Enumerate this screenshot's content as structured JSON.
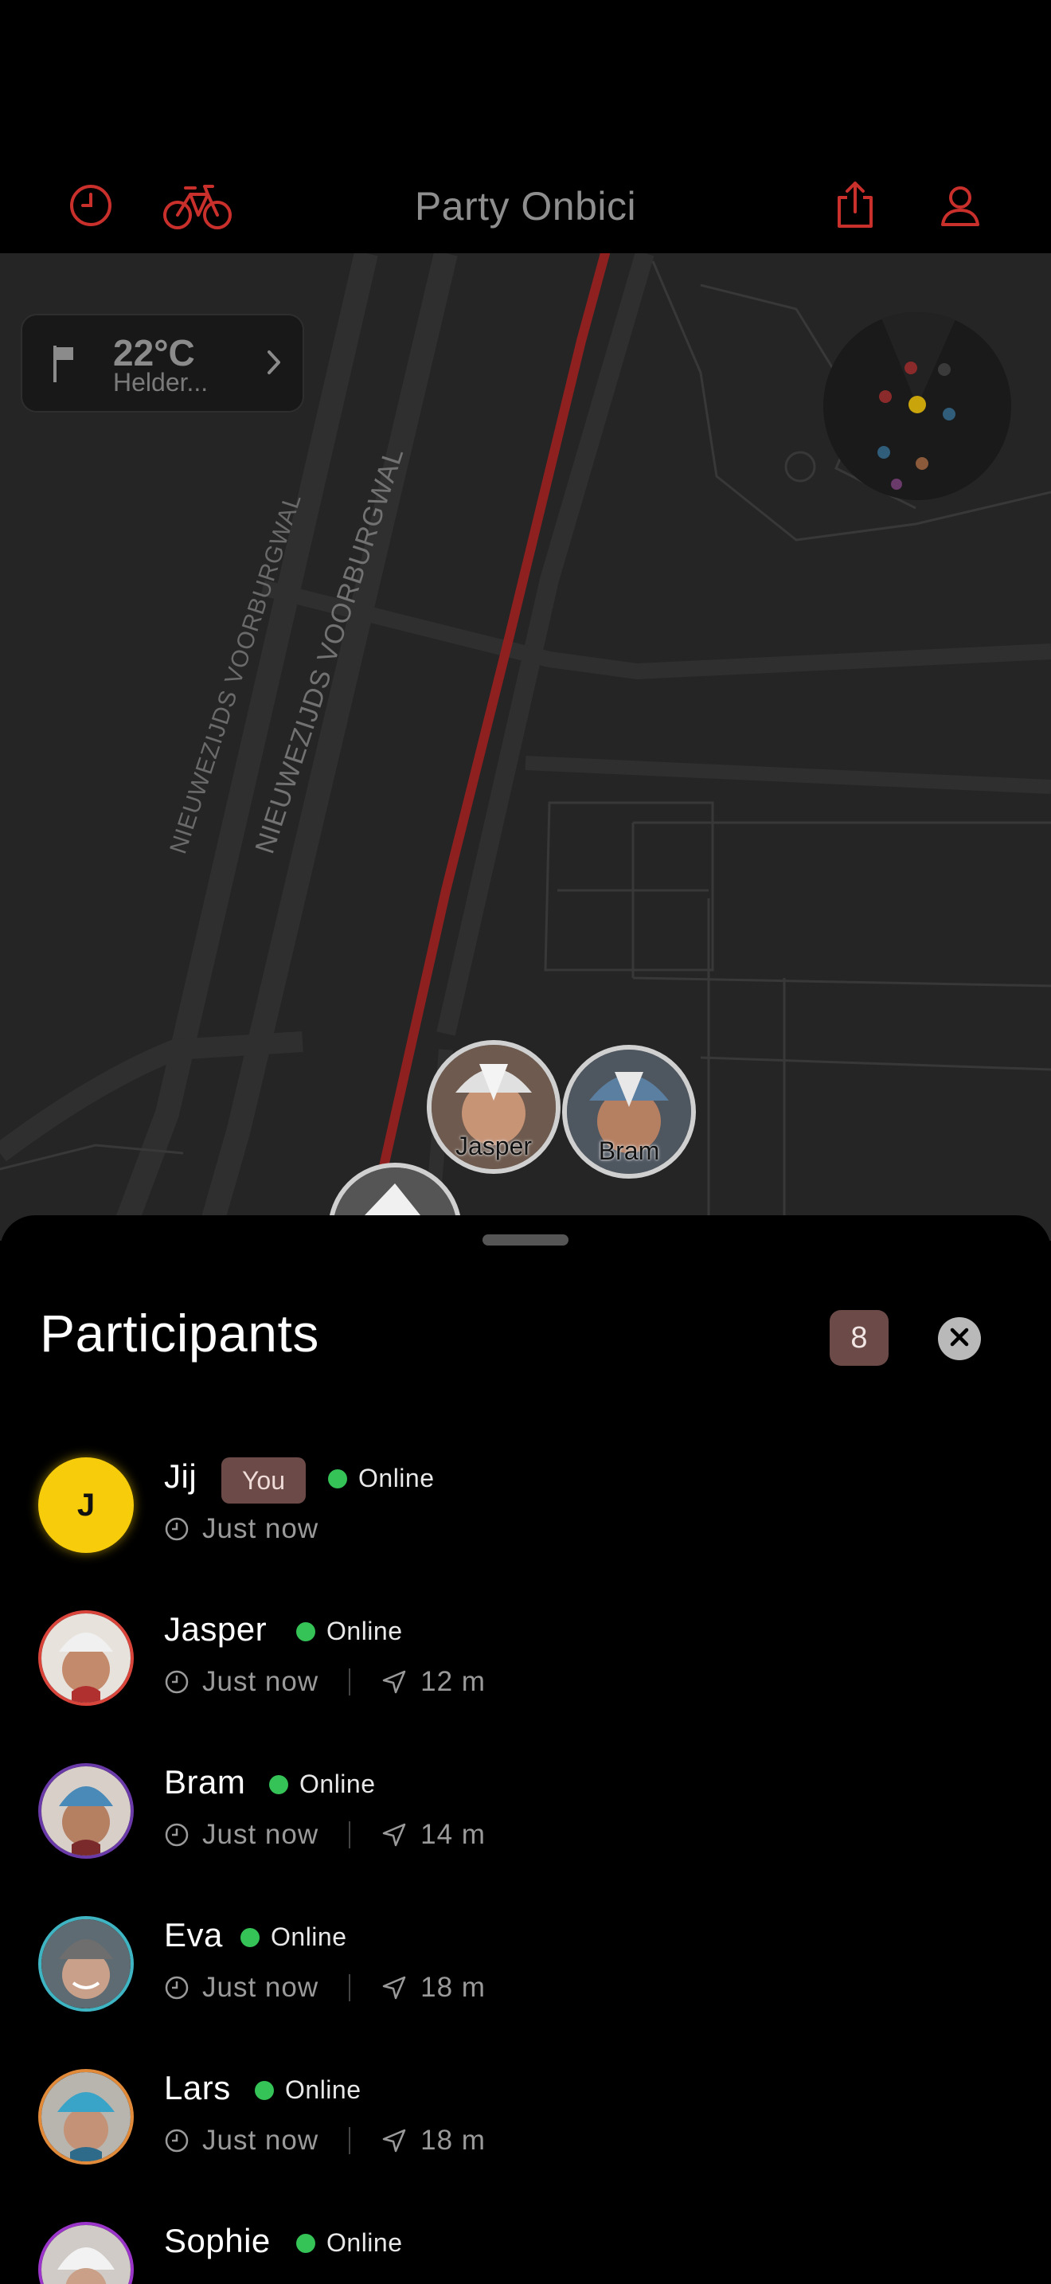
{
  "header": {
    "title": "Party Onbici"
  },
  "weather": {
    "temperature": "22°C",
    "condition": "Helder..."
  },
  "map": {
    "street_labels": [
      "NIEUWEZIJDS VOORBURGWAL",
      "NIEUWEZIJDS VOORBURGWAL"
    ],
    "pins": [
      {
        "label": "Jasper"
      },
      {
        "label": "Bram"
      }
    ],
    "route_color": "#8f2020"
  },
  "participants": {
    "title": "Participants",
    "count": "8",
    "list": [
      {
        "name": "Jij",
        "initial": "J",
        "you_label": "You",
        "status": "Online",
        "last_seen": "Just now",
        "distance": ""
      },
      {
        "name": "Jasper",
        "status": "Online",
        "last_seen": "Just now",
        "distance": "12 m",
        "ring_color": "#d9443b"
      },
      {
        "name": "Bram",
        "status": "Online",
        "last_seen": "Just now",
        "distance": "14 m",
        "ring_color": "#6a3aa8"
      },
      {
        "name": "Eva",
        "status": "Online",
        "last_seen": "Just now",
        "distance": "18 m",
        "ring_color": "#3fb5c4"
      },
      {
        "name": "Lars",
        "status": "Online",
        "last_seen": "Just now",
        "distance": "18 m",
        "ring_color": "#e08a3a"
      },
      {
        "name": "Sophie",
        "status": "Online",
        "last_seen": "",
        "distance": "",
        "ring_color": "#9b35c9"
      }
    ]
  },
  "colors": {
    "accent": "#c9302c",
    "online": "#35c256",
    "badge": "#6b4a47",
    "you_avatar": "#f7cc0a"
  }
}
